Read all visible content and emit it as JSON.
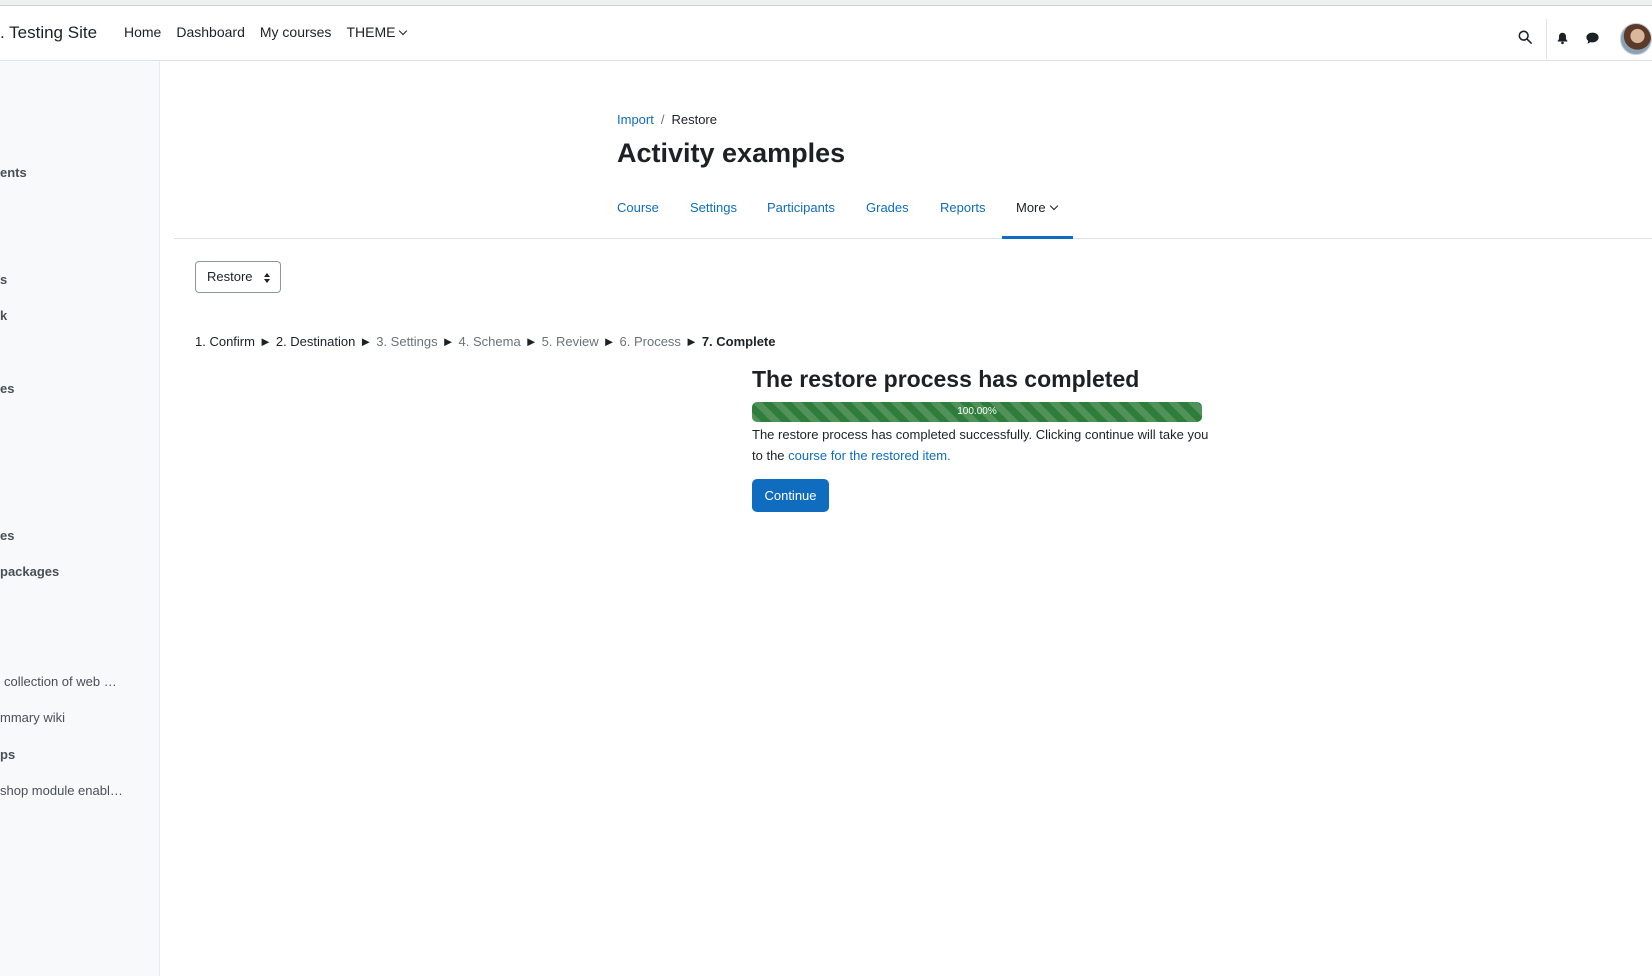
{
  "header": {
    "site_name": ". Testing Site",
    "nav": [
      {
        "label": "Home"
      },
      {
        "label": "Dashboard"
      },
      {
        "label": "My courses"
      },
      {
        "label": "THEME"
      }
    ]
  },
  "icons": {
    "search": "search-icon",
    "notifications": "bell-icon",
    "messages": "chat-icon",
    "user": "avatar"
  },
  "drawer": {
    "items": [
      {
        "label": "ents",
        "bold": true
      },
      {
        "label": "s",
        "bold": true
      },
      {
        "label": "k",
        "bold": true
      },
      {
        "label": "es",
        "bold": true
      },
      {
        "label": "es",
        "bold": true
      },
      {
        "label": "packages",
        "bold": true
      },
      {
        "label": "collection of web …",
        "bold": false
      },
      {
        "label": "mmary wiki",
        "bold": false
      },
      {
        "label": "ps",
        "bold": true
      },
      {
        "label": "shop module enabl…",
        "bold": false
      }
    ]
  },
  "breadcrumb": {
    "link": "Import",
    "separator": "/",
    "current": "Restore"
  },
  "page": {
    "title": "Activity examples"
  },
  "secondary_nav": {
    "tabs": [
      {
        "label": "Course"
      },
      {
        "label": "Settings"
      },
      {
        "label": "Participants"
      },
      {
        "label": "Grades"
      },
      {
        "label": "Reports"
      },
      {
        "label": "More"
      }
    ],
    "active": "More"
  },
  "select": {
    "value": "Restore"
  },
  "steps": [
    {
      "label": "1. Confirm",
      "state": "done"
    },
    {
      "label": "2. Destination",
      "state": "done"
    },
    {
      "label": "3. Settings",
      "state": "todo"
    },
    {
      "label": "4. Schema",
      "state": "todo"
    },
    {
      "label": "5. Review",
      "state": "todo"
    },
    {
      "label": "6. Process",
      "state": "todo"
    },
    {
      "label": "7. Complete",
      "state": "current"
    }
  ],
  "step_separator": "►",
  "result": {
    "title": "The restore process has completed",
    "progress_value": 1.0,
    "progress_label": "100.00%",
    "message_before": "The restore process has completed successfully. Clicking continue will take you to the ",
    "message_link": "course for the restored item.",
    "continue_label": "Continue"
  },
  "colors": {
    "link": "#0f6cbf",
    "progress": "#2f7d3a",
    "button": "#0f6cbf"
  }
}
